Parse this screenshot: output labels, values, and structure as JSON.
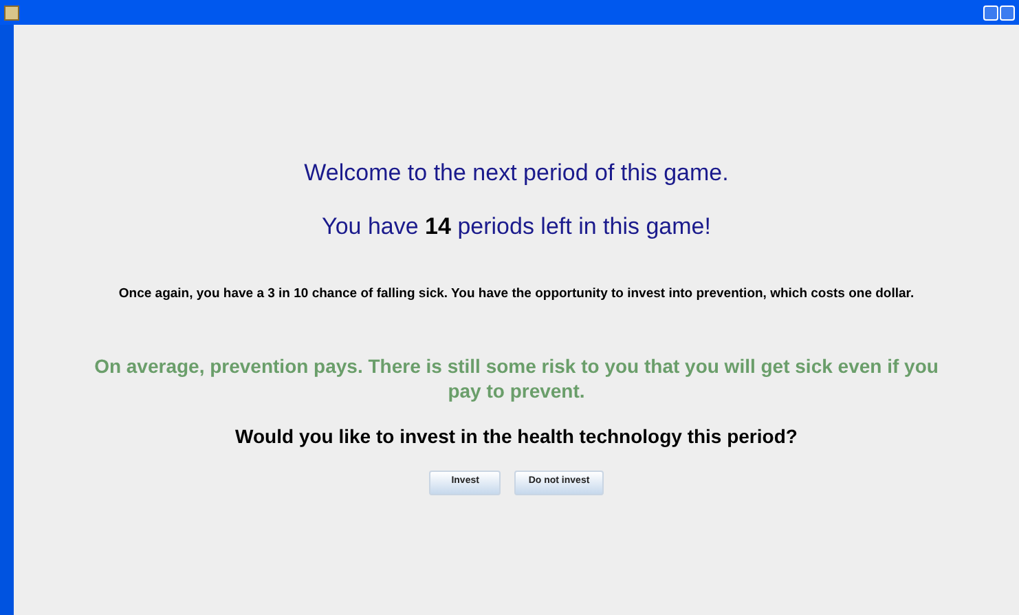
{
  "welcome": "Welcome to the next period of this game.",
  "periods": {
    "before": "You have ",
    "count": "14",
    "after": " periods left in this game!"
  },
  "info": "Once again, you have a 3 in 10 chance of falling sick. You have the opportunity to invest into prevention, which costs one dollar.",
  "advice": "On average, prevention pays. There is still some risk to you that you will get sick even if you pay to prevent.",
  "question": "Would you like to invest in the health technology this period?",
  "buttons": [
    "Invest",
    "Do not invest"
  ]
}
